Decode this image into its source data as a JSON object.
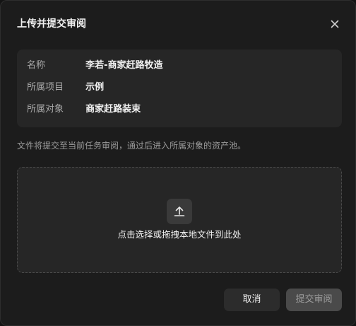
{
  "dialog": {
    "title": "上传并提交审阅",
    "close_icon": "close-icon"
  },
  "info": {
    "rows": [
      {
        "label": "名称",
        "value": "李若-商家赶路牧造"
      },
      {
        "label": "所属项目",
        "value": "示例"
      },
      {
        "label": "所属对象",
        "value": "商家赶路装束"
      }
    ]
  },
  "hint": "文件将提交至当前任务审阅，通过后进入所属对象的资产池。",
  "dropzone": {
    "icon": "upload-icon",
    "text": "点击选择或拖拽本地文件到此处"
  },
  "footer": {
    "cancel_label": "取消",
    "submit_label": "提交审阅",
    "submit_enabled": false
  }
}
